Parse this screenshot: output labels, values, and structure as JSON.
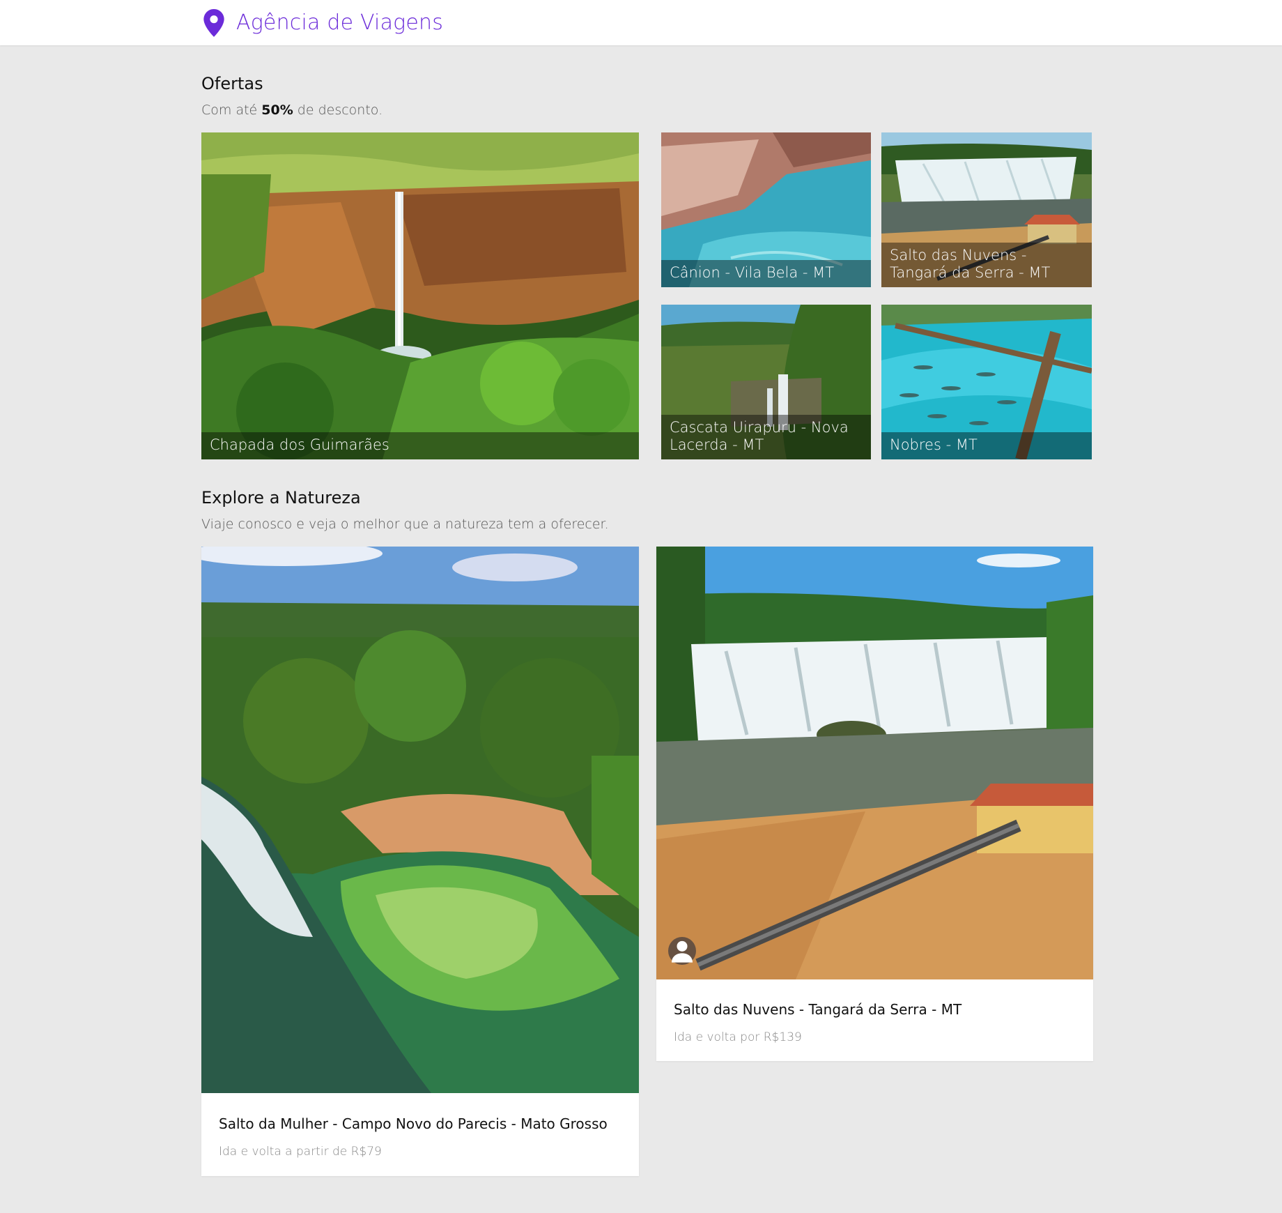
{
  "header": {
    "brand": "Agência de Viagens",
    "brand_icon": "location-pin-icon",
    "brand_color": "#6b2bd9"
  },
  "offers": {
    "title": "Ofertas",
    "subtitle_prefix": "Com até ",
    "subtitle_highlight": "50%",
    "subtitle_suffix": " de desconto.",
    "items": [
      {
        "label": "Chapada dos Guimarães"
      },
      {
        "label": "Cânion - Vila Bela - MT"
      },
      {
        "label": "Salto das Nuvens - Tangará da Serra - MT"
      },
      {
        "label": "Cascata Uirapuru - Nova Lacerda - MT"
      },
      {
        "label": "Nobres - MT"
      }
    ]
  },
  "explore": {
    "title": "Explore a Natureza",
    "subtitle": "Viaje conosco e veja o melhor que a natureza tem a oferecer.",
    "cards": [
      {
        "title": "Salto da Mulher - Campo Novo do Parecis - Mato Grosso",
        "subtitle": "Ida e volta a partir de R$79"
      },
      {
        "title": "Salto das Nuvens - Tangará da Serra - MT",
        "subtitle": "Ida e volta por R$139",
        "avatar_icon": "person-icon"
      }
    ]
  }
}
